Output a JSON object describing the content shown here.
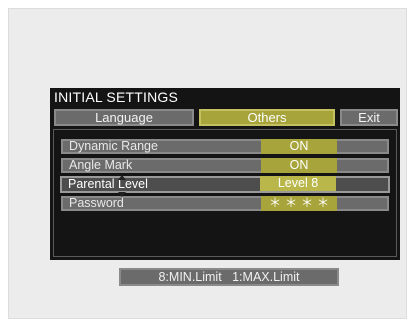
{
  "menu": {
    "title": "INITIAL SETTINGS",
    "tabs": [
      {
        "label": "Language",
        "active": false
      },
      {
        "label": "Others",
        "active": true
      },
      {
        "label": "Exit",
        "active": false
      }
    ]
  },
  "settings": [
    {
      "label": "Dynamic Range",
      "value": "ON"
    },
    {
      "label": "Angle Mark",
      "value": "ON"
    },
    {
      "label": "Parental Level",
      "value": "Level  8",
      "selected": true
    },
    {
      "label": "Password",
      "value": "＊ ＊ ＊ ＊"
    }
  ],
  "hint": {
    "min_limit": "8:MIN.Limit",
    "max_limit": "1:MAX.Limit"
  },
  "colors": {
    "active_accent": "#a6a43a",
    "tab_gray": "#6b6b6b",
    "panel_bg": "#141414"
  }
}
